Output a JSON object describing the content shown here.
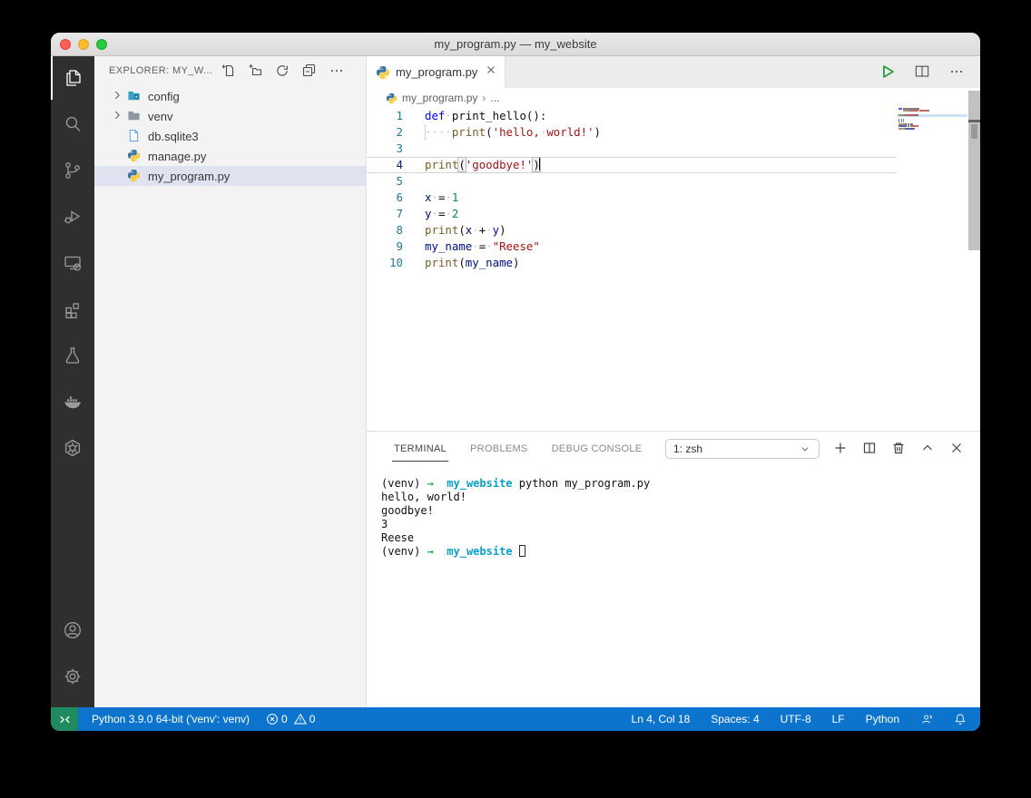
{
  "window": {
    "title": "my_program.py — my_website"
  },
  "activity_bar": {
    "items": [
      "explorer",
      "search",
      "source-control",
      "run-and-debug",
      "remote-explorer",
      "extensions",
      "testing",
      "docker",
      "kubernetes",
      "accounts",
      "settings"
    ]
  },
  "sidebar": {
    "header": {
      "title": "EXPLORER: MY_W...",
      "actions": [
        "new-file",
        "new-folder",
        "refresh-explorer",
        "collapse-folders",
        "more-actions"
      ]
    },
    "files": [
      {
        "label": "config",
        "type": "folder-config",
        "chevron": true
      },
      {
        "label": "venv",
        "type": "folder",
        "chevron": true
      },
      {
        "label": "db.sqlite3",
        "type": "file"
      },
      {
        "label": "manage.py",
        "type": "python"
      },
      {
        "label": "my_program.py",
        "type": "python",
        "selected": true
      }
    ]
  },
  "editor": {
    "tab": {
      "label": "my_program.py"
    },
    "breadcrumb": {
      "file": "my_program.py",
      "separator": "›",
      "more": "..."
    },
    "cursor": {
      "line": 4,
      "col": 18
    },
    "code": [
      {
        "num": "1",
        "segs": [
          [
            "def",
            "kw"
          ],
          [
            "·",
            "ws"
          ],
          [
            "print_hello():",
            "pln"
          ]
        ]
      },
      {
        "num": "2",
        "indent_guide": true,
        "segs": [
          [
            "····",
            "ws"
          ],
          [
            "print",
            "fn"
          ],
          [
            "(",
            "pln"
          ],
          [
            "'hello,",
            "str"
          ],
          [
            "·",
            "ws"
          ],
          [
            "world!'",
            "str"
          ],
          [
            ")",
            "pln"
          ]
        ]
      },
      {
        "num": "3",
        "segs": []
      },
      {
        "num": "4",
        "current": true,
        "cursor": true,
        "segs": [
          [
            "print",
            "fn"
          ],
          [
            "(",
            "brk"
          ],
          [
            "'goodbye!'",
            "str"
          ],
          [
            ")",
            "brk"
          ]
        ]
      },
      {
        "num": "5",
        "segs": []
      },
      {
        "num": "6",
        "segs": [
          [
            "x",
            "var"
          ],
          [
            "·",
            "ws"
          ],
          [
            "=",
            "pln"
          ],
          [
            "·",
            "ws"
          ],
          [
            "1",
            "num"
          ]
        ]
      },
      {
        "num": "7",
        "segs": [
          [
            "y",
            "var"
          ],
          [
            "·",
            "ws"
          ],
          [
            "=",
            "pln"
          ],
          [
            "·",
            "ws"
          ],
          [
            "2",
            "num"
          ]
        ]
      },
      {
        "num": "8",
        "segs": [
          [
            "print",
            "fn"
          ],
          [
            "(",
            "pln"
          ],
          [
            "x",
            "var"
          ],
          [
            "·",
            "ws"
          ],
          [
            "+",
            "pln"
          ],
          [
            "·",
            "ws"
          ],
          [
            "y",
            "var"
          ],
          [
            ")",
            "pln"
          ]
        ]
      },
      {
        "num": "9",
        "segs": [
          [
            "my_name",
            "var"
          ],
          [
            "·",
            "ws"
          ],
          [
            "=",
            "pln"
          ],
          [
            "·",
            "ws"
          ],
          [
            "\"Reese\"",
            "str"
          ]
        ]
      },
      {
        "num": "10",
        "segs": [
          [
            "print",
            "fn"
          ],
          [
            "(",
            "pln"
          ],
          [
            "my_name",
            "var"
          ],
          [
            ")",
            "pln"
          ]
        ]
      }
    ]
  },
  "panel": {
    "tabs": [
      {
        "label": "TERMINAL",
        "active": true
      },
      {
        "label": "PROBLEMS",
        "active": false
      },
      {
        "label": "DEBUG CONSOLE",
        "active": false
      }
    ],
    "shell_selector": "1: zsh",
    "actions": [
      "new-terminal",
      "split-terminal",
      "kill-terminal",
      "maximize-panel",
      "close-panel"
    ],
    "terminal": [
      {
        "segs": [
          [
            "(venv) ",
            "pln"
          ],
          [
            "→",
            "grn"
          ],
          [
            "  ",
            "pln"
          ],
          [
            "my_website",
            "cyn"
          ],
          [
            " python my_program.py",
            "pln"
          ]
        ]
      },
      {
        "segs": [
          [
            "hello, world!",
            "pln"
          ]
        ]
      },
      {
        "segs": [
          [
            "goodbye!",
            "pln"
          ]
        ]
      },
      {
        "segs": [
          [
            "3",
            "pln"
          ]
        ]
      },
      {
        "segs": [
          [
            "Reese",
            "pln"
          ]
        ]
      },
      {
        "segs": [
          [
            "(venv) ",
            "pln"
          ],
          [
            "→",
            "grn"
          ],
          [
            "  ",
            "pln"
          ],
          [
            "my_website",
            "cyn"
          ],
          [
            " ",
            "pln"
          ]
        ],
        "cursor": true
      }
    ]
  },
  "status_bar": {
    "python_version": "Python 3.9.0 64-bit ('venv': venv)",
    "errors": "0",
    "warnings": "0",
    "line_col": "Ln 4, Col 18",
    "spaces": "Spaces: 4",
    "encoding": "UTF-8",
    "eol": "LF",
    "language": "Python"
  },
  "colors": {
    "status_blue": "#0d74ce",
    "remote_green": "#208b61",
    "keyword": "#0000ff",
    "function": "#795e26",
    "string": "#a31515",
    "number": "#098658",
    "variable": "#001080",
    "terminal_green": "#2db44d",
    "terminal_cyan": "#0aa0c8",
    "run_green": "#2f9e44"
  }
}
